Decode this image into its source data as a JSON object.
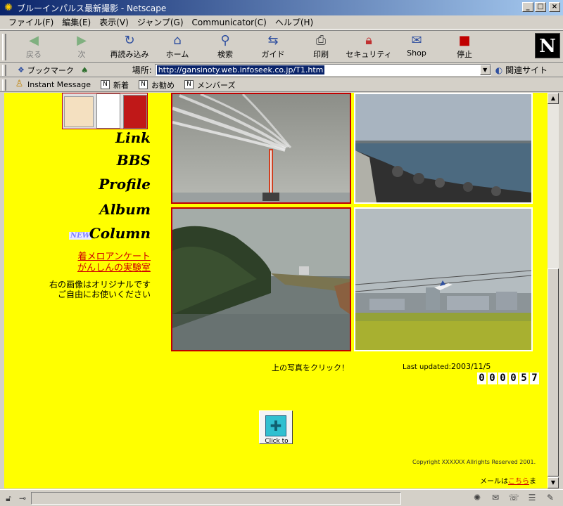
{
  "window": {
    "title": "ブルーインパルス最新撮影 - Netscape",
    "minimize": "_",
    "maximize": "□",
    "close": "×"
  },
  "menu": [
    "ファイル(F)",
    "編集(E)",
    "表示(V)",
    "ジャンプ(G)",
    "Communicator(C)",
    "ヘルプ(H)"
  ],
  "toolbar": {
    "back": "戻る",
    "forward": "次",
    "reload": "再読み込み",
    "home": "ホーム",
    "search": "検索",
    "guide": "ガイド",
    "print": "印刷",
    "security": "セキュリティ",
    "shop": "Shop",
    "stop": "停止",
    "logo": "N"
  },
  "location": {
    "bookmarks": "ブックマーク",
    "label": "場所:",
    "url": "http://gansinoty.web.infoseek.co.jp/T1.htm",
    "related": "関連サイト"
  },
  "personal": {
    "instant_message": "Instant Message",
    "whats_new": "新着",
    "recommended": "お勧め",
    "members": "メンバーズ"
  },
  "sidebar": {
    "links": [
      "Link",
      "BBS",
      "Profile",
      "Album",
      "Column"
    ],
    "new_badge": "NEW",
    "survey_link": "着メロアンケート",
    "lab_link": "がんしんの実験室",
    "note_line1": "右の画像はオリジナルです",
    "note_line2": "ご自由にお使いください"
  },
  "photos": {
    "top_left": "crane-smoke-trails",
    "top_right": "breakwater-sea",
    "bottom_left": "river",
    "bottom_right": "airport-airplane"
  },
  "main": {
    "click_hint": "上の写真をクリック！",
    "last_updated_label": "Last updated:",
    "last_updated_date": "2003/11/5",
    "counter_digits": [
      "0",
      "0",
      "0",
      "0",
      "5",
      "7"
    ],
    "plugin_label": "Click to",
    "copyright": "Copyright XXXXXX Allrights Reserved 2001.",
    "mail_prefix": "メールは",
    "mail_link": "こちら",
    "mail_suffix": "まで。"
  },
  "colors": {
    "page_bg": "#ffff00",
    "link_red": "#d00000",
    "title_bar": "#0a246a"
  }
}
